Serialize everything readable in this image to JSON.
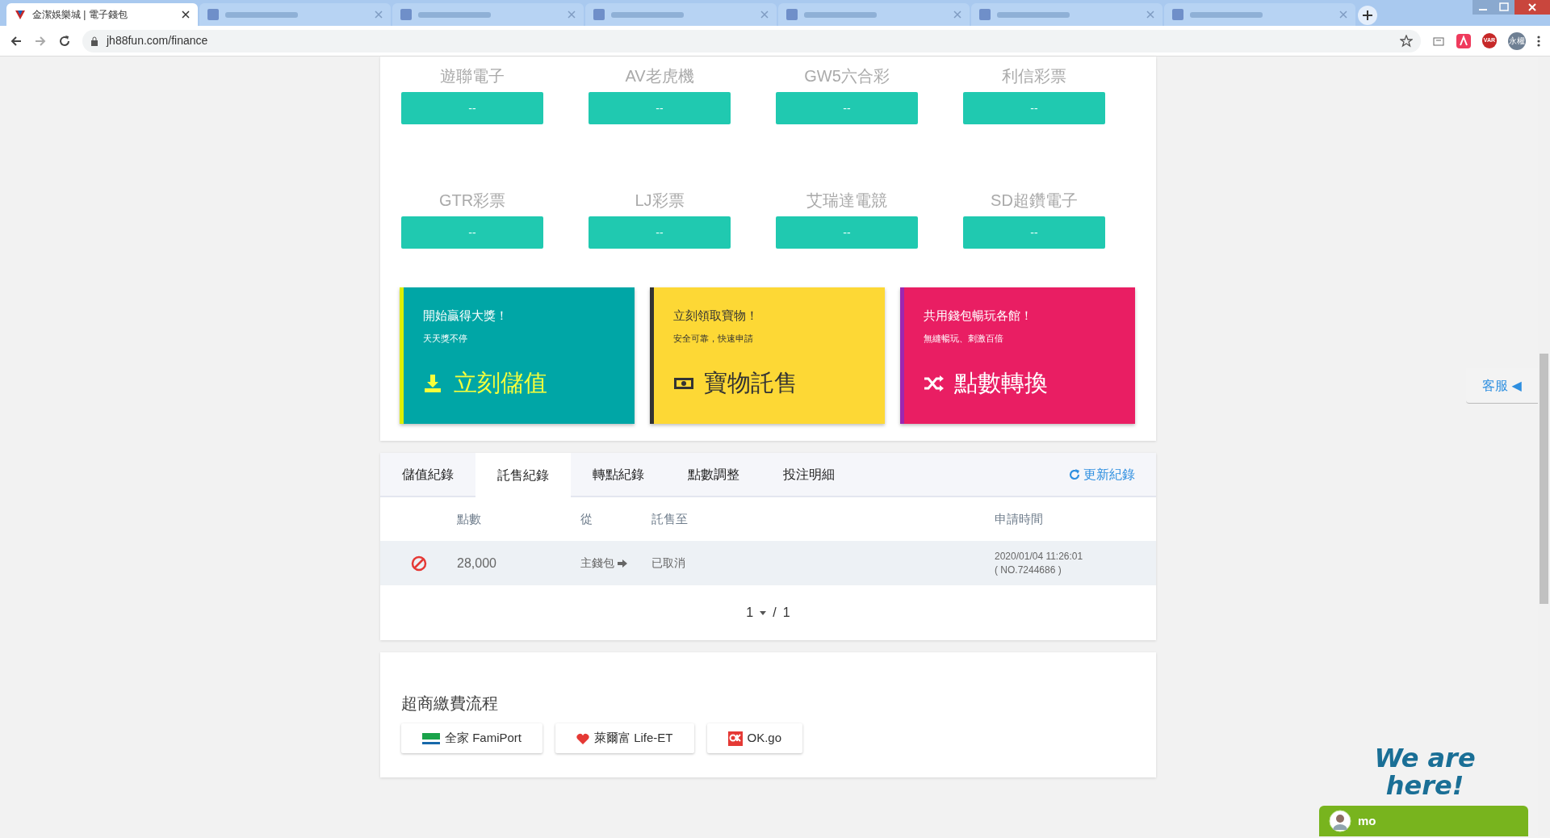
{
  "browser": {
    "tabs": [
      {
        "title": "金潔娛樂城 | 電子錢包",
        "selected": true
      },
      {
        "selected": false
      },
      {
        "selected": false
      },
      {
        "selected": false
      },
      {
        "selected": false
      },
      {
        "selected": false
      },
      {
        "selected": false
      }
    ],
    "url": "jh88fun.com/finance",
    "extension_badge": "VAR",
    "profile": "永權"
  },
  "games": [
    {
      "name": "遊聯電子",
      "balance": "--"
    },
    {
      "name": "AV老虎機",
      "balance": "--"
    },
    {
      "name": "GW5六合彩",
      "balance": "--"
    },
    {
      "name": "利信彩票",
      "balance": "--"
    },
    {
      "name": "GTR彩票",
      "balance": "--"
    },
    {
      "name": "LJ彩票",
      "balance": "--"
    },
    {
      "name": "艾瑞達電競",
      "balance": "--"
    },
    {
      "name": "SD超鑽電子",
      "balance": "--"
    }
  ],
  "action_cards": [
    {
      "kind": "deposit",
      "title": "開始贏得大獎！",
      "subtitle": "天天獎不停",
      "action": "立刻儲值",
      "color": "#00a6a6"
    },
    {
      "kind": "sell",
      "title": "立刻領取寶物！",
      "subtitle": "安全可靠，快速申請",
      "action": "寶物託售",
      "color": "#fdd835"
    },
    {
      "kind": "transfer",
      "title": "共用錢包暢玩各館！",
      "subtitle": "無縫暢玩、刺激百倍",
      "action": "點數轉換",
      "color": "#e91e63"
    }
  ],
  "record_tabs": [
    {
      "label": "儲值紀錄",
      "selected": false
    },
    {
      "label": "託售紀錄",
      "selected": true
    },
    {
      "label": "轉點紀錄",
      "selected": false
    },
    {
      "label": "點數調整",
      "selected": false
    },
    {
      "label": "投注明細",
      "selected": false
    }
  ],
  "refresh": "更新紀錄",
  "table": {
    "columns": [
      "點數",
      "從",
      "託售至",
      "申請時間"
    ],
    "rows": [
      {
        "kind": "cancelled",
        "points": "28,000",
        "from": "主錢包",
        "to": "已取消",
        "time": "2020/01/04 11:26:01",
        "ref": "( NO.7244686 )"
      }
    ]
  },
  "pagination": {
    "page": "1",
    "separator": "/",
    "total": "1"
  },
  "payment": {
    "title": "超商繳費流程",
    "options": [
      {
        "kind": "family",
        "label": "全家 FamiPort"
      },
      {
        "kind": "life",
        "label": "萊爾富 Life-ET"
      },
      {
        "kind": "ok",
        "label": "OK.go"
      }
    ]
  },
  "support": "客服 ◀",
  "chat": {
    "banner": "We are here!",
    "name": "mo"
  }
}
